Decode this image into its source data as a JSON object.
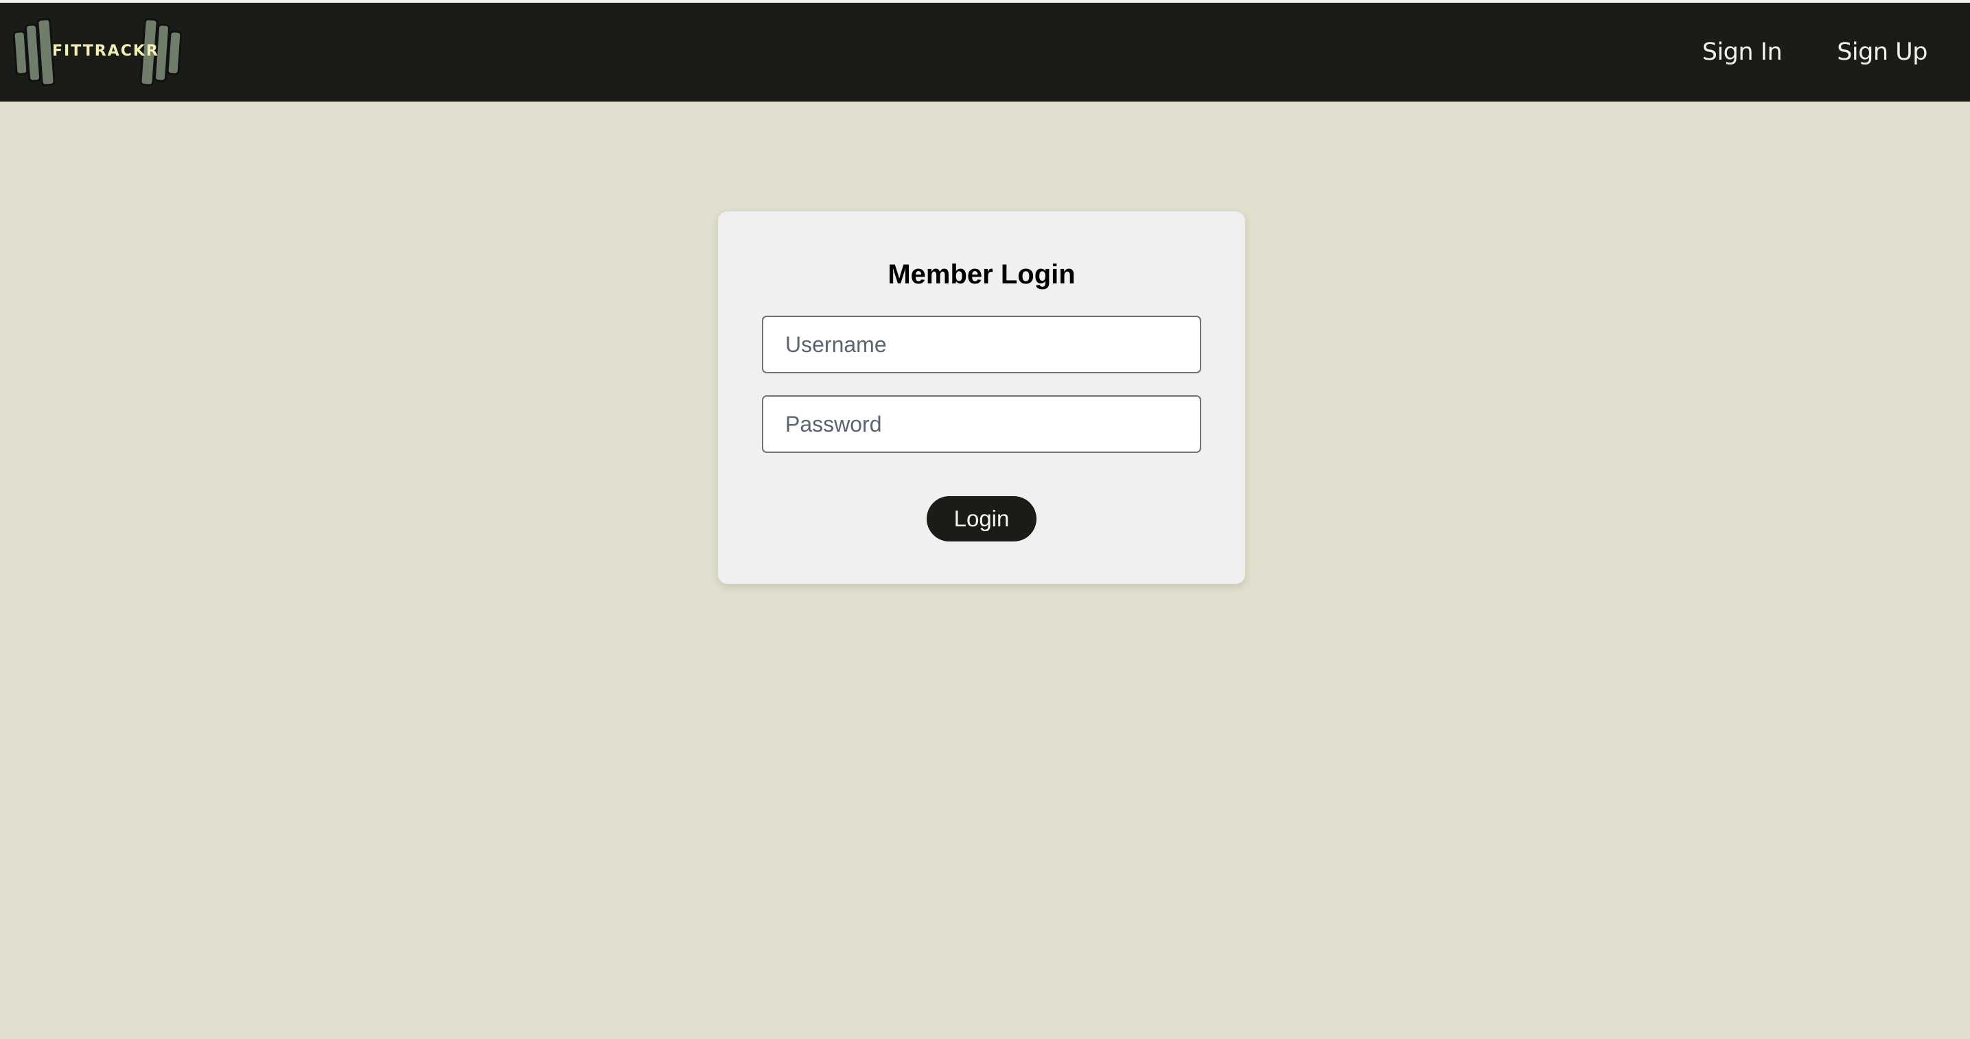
{
  "brand": {
    "name": "FITTRACKR",
    "logo_icon": "dumbbell-logo-icon"
  },
  "nav": {
    "sign_in_label": "Sign In",
    "sign_up_label": "Sign Up"
  },
  "login_form": {
    "title": "Member Login",
    "username_placeholder": "Username",
    "username_value": "",
    "password_placeholder": "Password",
    "password_value": "",
    "submit_label": "Login"
  },
  "colors": {
    "page_background": "#e1dfcd",
    "navbar_background": "#1a1c17",
    "card_background": "#f0f0f0",
    "button_background": "#1a1c17",
    "logo_plate": "#6f7d6a",
    "logo_text": "#f2f0b8"
  }
}
